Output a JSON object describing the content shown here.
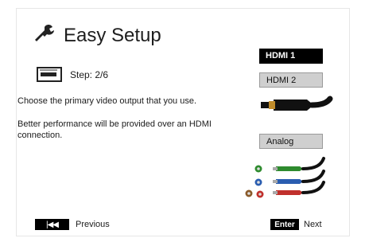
{
  "title": "Easy Setup",
  "icons": {
    "title": "wrench-icon",
    "step": "video-output-icon",
    "prev": "skip-previous-icon"
  },
  "step": {
    "label": "Step: 2/6"
  },
  "description": {
    "line1": "Choose the primary video output that you use.",
    "line2": "Better performance will be provided over an HDMI connection."
  },
  "options": [
    {
      "label": "HDMI 1",
      "state": "selected"
    },
    {
      "label": "HDMI 2",
      "state": "normal"
    },
    {
      "label": "Analog",
      "state": "normal"
    }
  ],
  "footer": {
    "previous_label": "Previous",
    "enter_button": "Enter",
    "next_label": "Next"
  },
  "colors": {
    "selected_bg": "#000000",
    "option_bg": "#cfcfcf",
    "cable_green": "#2e8b2e",
    "cable_blue": "#2a5db0",
    "cable_red": "#c0302c"
  }
}
